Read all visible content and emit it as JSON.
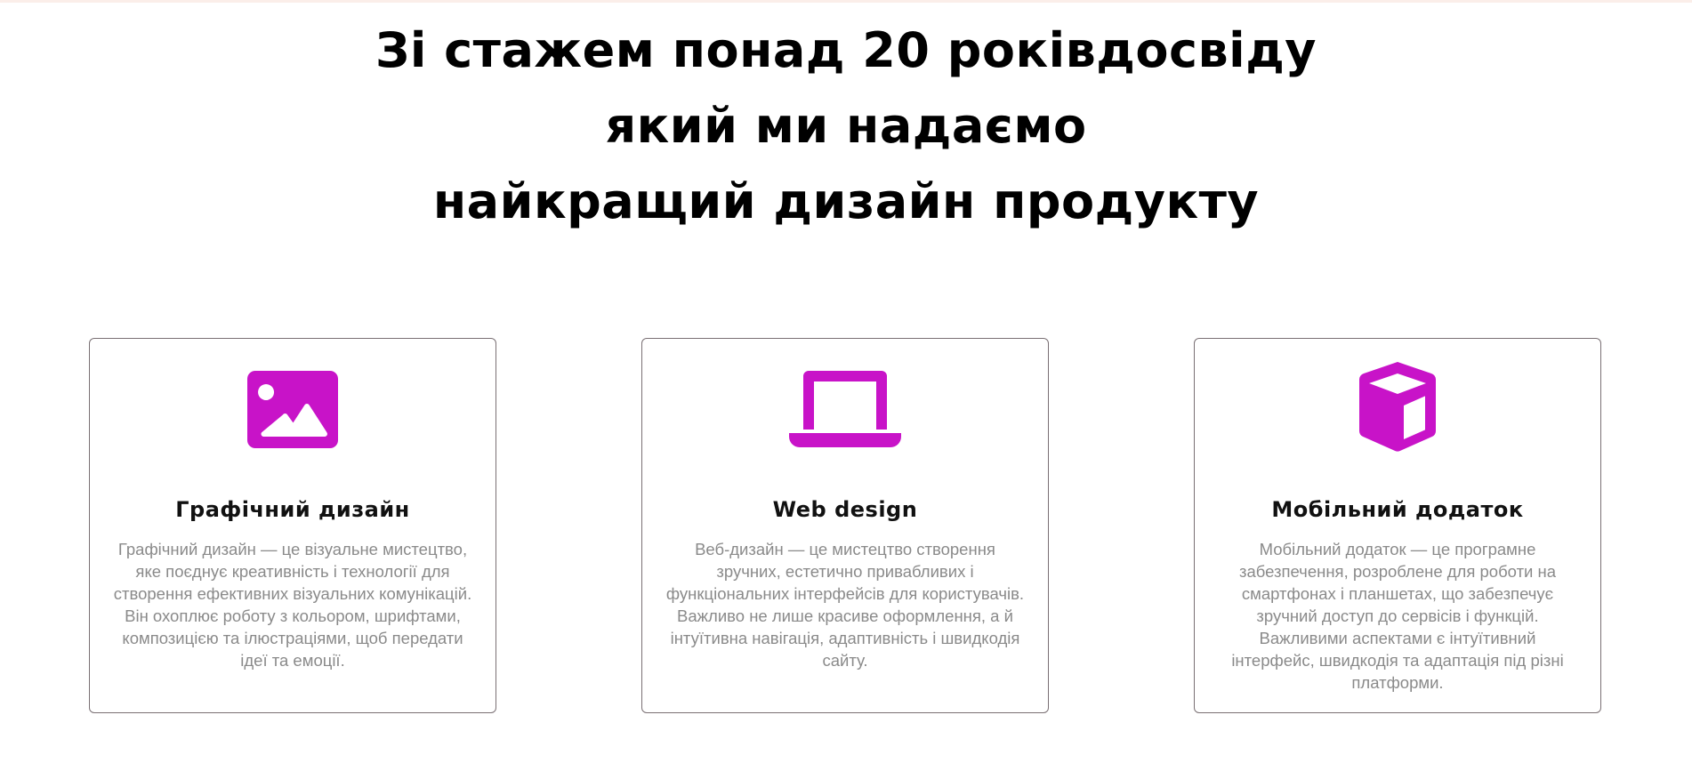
{
  "theme": {
    "accent": "#c813c8",
    "title_color": "#000000",
    "text_color": "#8a8a8a",
    "border_color": "#7a7074"
  },
  "hero": {
    "line1": "Зі стажем понад 20 роківдосвіду",
    "line2": "який ми надаємо",
    "line3": "найкращий дизайн продукту"
  },
  "cards": [
    {
      "icon": "image-icon",
      "title": "Графічний дизайн",
      "text": "Графічний дизайн — це візуальне мистецтво, яке поєднує креативність і технології для створення ефективних візуальних комунікацій. Він охоплює роботу з кольором, шрифтами, композицією та ілюстраціями, щоб передати ідеї та емоції."
    },
    {
      "icon": "laptop-icon",
      "title": "Web design",
      "text": "Веб-дизайн — це мистецтво створення зручних, естетично привабливих і функціональних інтерфейсів для користувачів. Важливо не лише красиве оформлення, а й інтуїтивна навігація, адаптивність і швидкодія сайту."
    },
    {
      "icon": "cube-icon",
      "title": "Мобільний додаток",
      "text": "Мобільний додаток — це програмне забезпечення, розроблене для роботи на смартфонах і планшетах, що забезпечує зручний доступ до сервісів і функцій. Важливими аспектами є інтуїтивний інтерфейс, швидкодія та адаптація під різні платформи."
    }
  ]
}
